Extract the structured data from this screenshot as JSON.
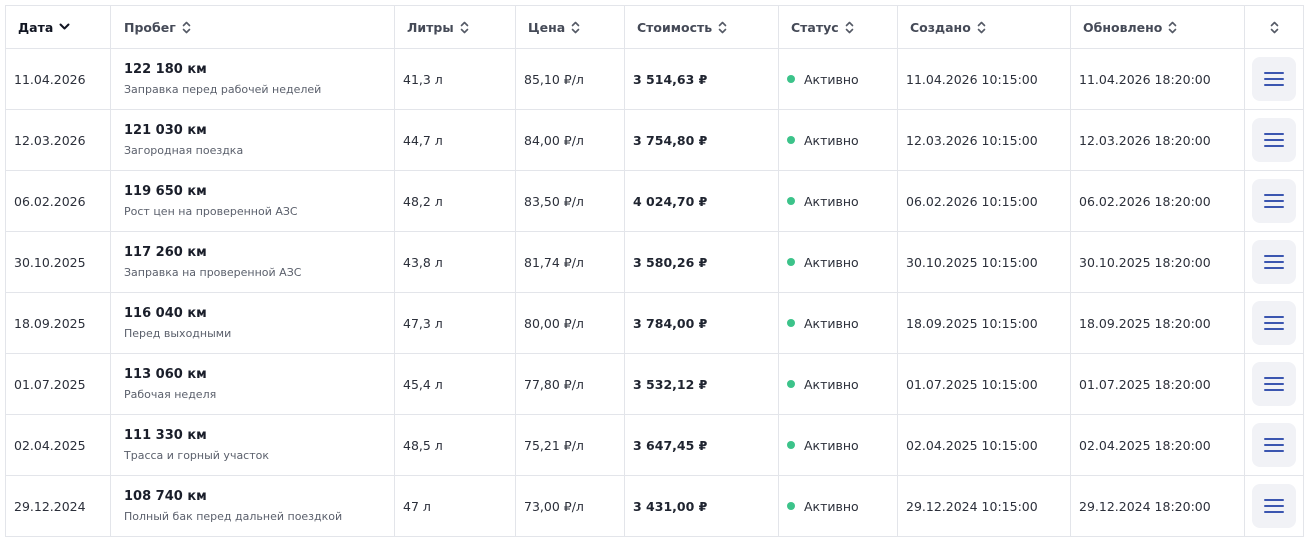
{
  "colors": {
    "accent": "#3b56b0",
    "status_active": "#3cc38a",
    "border": "#e3e5ea"
  },
  "header": {
    "date": "Дата",
    "mileage": "Пробег",
    "liters": "Литры",
    "price": "Цена",
    "cost": "Стоимость",
    "status": "Статус",
    "created": "Создано",
    "updated": "Обновлено"
  },
  "rows": [
    {
      "date": "11.04.2026",
      "mileage": "122 180 км",
      "note": "Заправка перед рабочей неделей",
      "liters": "41,3 л",
      "price": "85,10 ₽/л",
      "cost": "3 514,63 ₽",
      "status": "Активно",
      "created": "11.04.2026 10:15:00",
      "updated": "11.04.2026 18:20:00"
    },
    {
      "date": "12.03.2026",
      "mileage": "121 030 км",
      "note": "Загородная поездка",
      "liters": "44,7 л",
      "price": "84,00 ₽/л",
      "cost": "3 754,80 ₽",
      "status": "Активно",
      "created": "12.03.2026 10:15:00",
      "updated": "12.03.2026 18:20:00"
    },
    {
      "date": "06.02.2026",
      "mileage": "119 650 км",
      "note": "Рост цен на проверенной АЗС",
      "liters": "48,2 л",
      "price": "83,50 ₽/л",
      "cost": "4 024,70 ₽",
      "status": "Активно",
      "created": "06.02.2026 10:15:00",
      "updated": "06.02.2026 18:20:00"
    },
    {
      "date": "30.10.2025",
      "mileage": "117 260 км",
      "note": "Заправка на проверенной АЗС",
      "liters": "43,8 л",
      "price": "81,74 ₽/л",
      "cost": "3 580,26 ₽",
      "status": "Активно",
      "created": "30.10.2025 10:15:00",
      "updated": "30.10.2025 18:20:00"
    },
    {
      "date": "18.09.2025",
      "mileage": "116 040 км",
      "note": "Перед выходными",
      "liters": "47,3 л",
      "price": "80,00 ₽/л",
      "cost": "3 784,00 ₽",
      "status": "Активно",
      "created": "18.09.2025 10:15:00",
      "updated": "18.09.2025 18:20:00"
    },
    {
      "date": "01.07.2025",
      "mileage": "113 060 км",
      "note": "Рабочая неделя",
      "liters": "45,4 л",
      "price": "77,80 ₽/л",
      "cost": "3 532,12 ₽",
      "status": "Активно",
      "created": "01.07.2025 10:15:00",
      "updated": "01.07.2025 18:20:00"
    },
    {
      "date": "02.04.2025",
      "mileage": "111 330 км",
      "note": "Трасса и горный участок",
      "liters": "48,5 л",
      "price": "75,21 ₽/л",
      "cost": "3 647,45 ₽",
      "status": "Активно",
      "created": "02.04.2025 10:15:00",
      "updated": "02.04.2025 18:20:00"
    },
    {
      "date": "29.12.2024",
      "mileage": "108 740 км",
      "note": "Полный бак перед дальней поездкой",
      "liters": "47 л",
      "price": "73,00 ₽/л",
      "cost": "3 431,00 ₽",
      "status": "Активно",
      "created": "29.12.2024 10:15:00",
      "updated": "29.12.2024 18:20:00"
    }
  ]
}
